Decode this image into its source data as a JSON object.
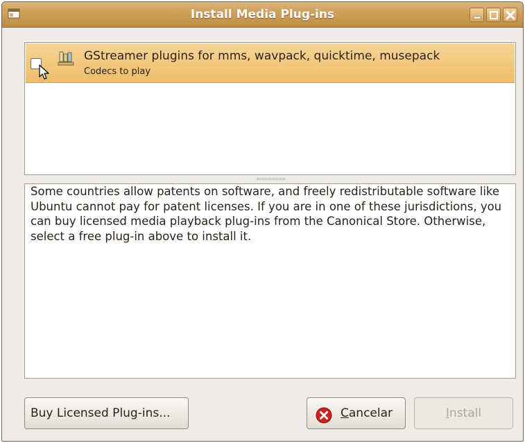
{
  "window": {
    "title": "Install Media Plug-ins",
    "icon": "app-window-icon",
    "controls": [
      "minimize-icon",
      "maximize-icon",
      "close-icon"
    ]
  },
  "plugin_list": {
    "items": [
      {
        "title": "GStreamer plugins for mms, wavpack, quicktime, musepack",
        "subtitle": "Codecs to play",
        "checked": false,
        "selected": true,
        "icon": "plugin-package-icon"
      }
    ]
  },
  "description": {
    "text": "Some countries allow patents on software, and freely redistributable software like Ubuntu cannot pay for patent licenses. If you are in one of these jurisdictions, you can buy licensed media playback plug-ins from the Canonical Store. Otherwise, select a free plug-in above to install it."
  },
  "buttons": {
    "buy_label": "Buy Licensed Plug-ins...",
    "cancel_mnemonic": "C",
    "cancel_rest": "ancelar",
    "cancel_icon": "cancel-icon",
    "install_mnemonic": "I",
    "install_rest": "nstall",
    "install_enabled": false
  },
  "colors": {
    "titlebar": "#cf9f5a",
    "selection": "#f2c77d",
    "window_bg": "#efebe7",
    "cancel_red": "#cc2222"
  }
}
